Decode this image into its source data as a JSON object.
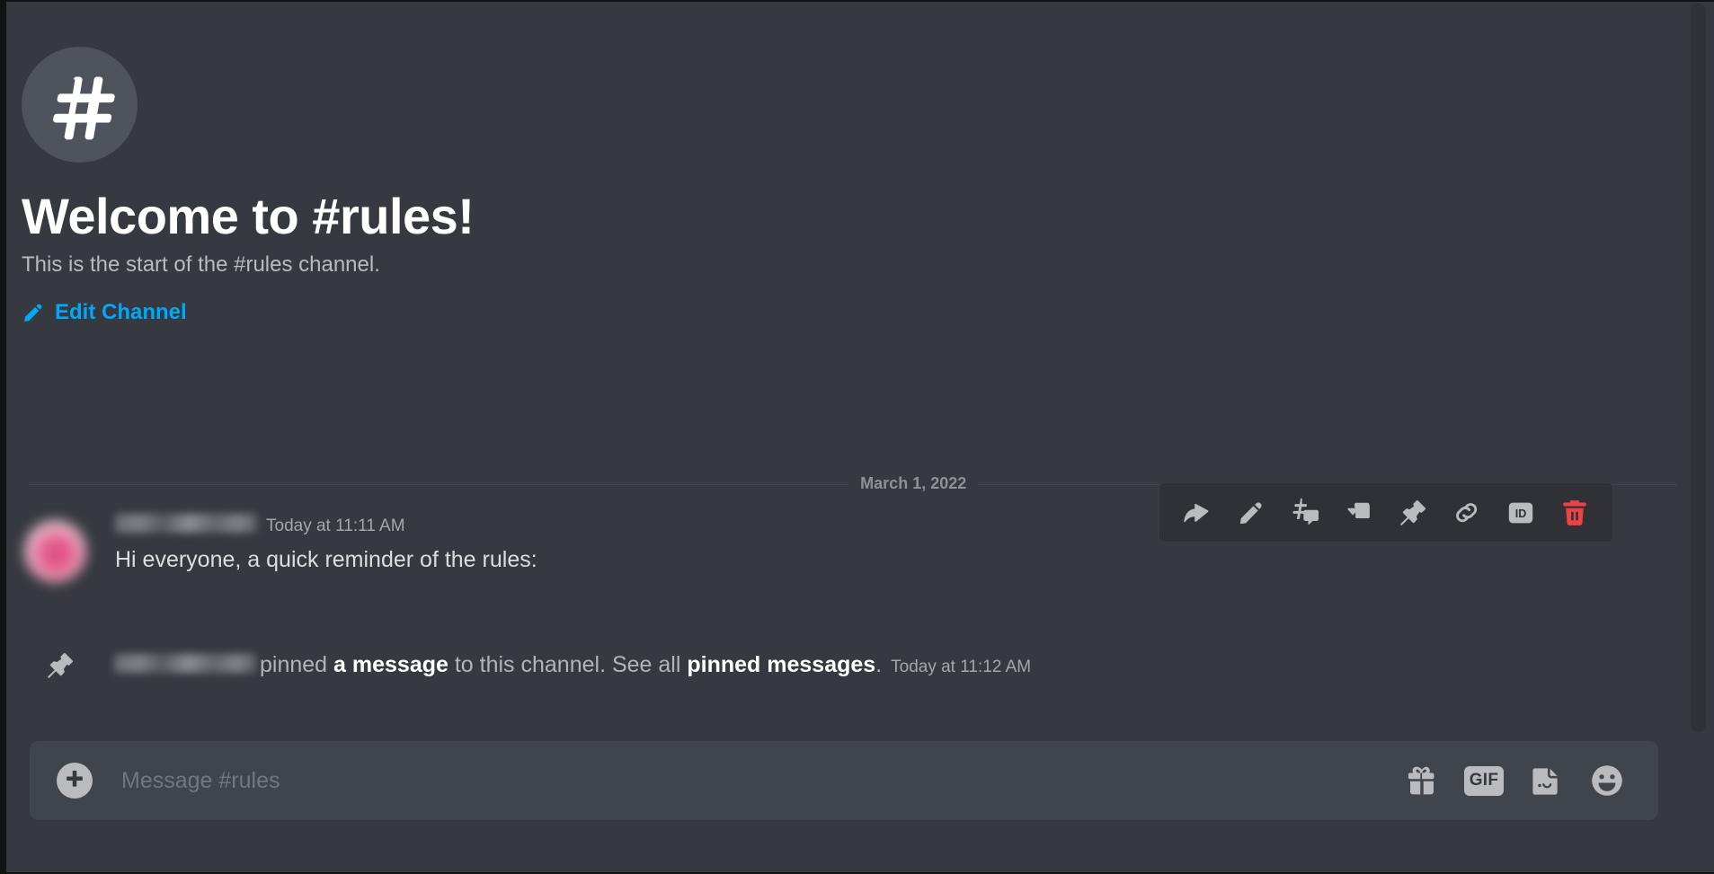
{
  "app": {
    "platform": "discord-channel-view",
    "background_color": "#36393f",
    "accent_color": "#00a8fc",
    "danger_color": "#ed4245"
  },
  "channel": {
    "name": "#rules",
    "welcome_title": "Welcome to #rules!",
    "intro_text": "This is the start of the #rules channel.",
    "edit_channel_label": "Edit Channel",
    "hash_icon": "hash-icon",
    "edit_icon": "pencil-icon"
  },
  "date_divider": {
    "label": "March 1, 2022"
  },
  "message": {
    "author_redacted": "",
    "timestamp": "Today at 11:11 AM",
    "content": "Hi everyone, a quick reminder of the rules:"
  },
  "hover_toolbar": {
    "buttons": [
      {
        "name": "reply-icon",
        "label": "Reply"
      },
      {
        "name": "edit-pencil-icon",
        "label": "Edit"
      },
      {
        "name": "crosspost-icon",
        "label": "Publish"
      },
      {
        "name": "mark-unread-icon",
        "label": "Mark Unread"
      },
      {
        "name": "pin-icon",
        "label": "Pin Message"
      },
      {
        "name": "copy-link-icon",
        "label": "Copy Message Link"
      },
      {
        "name": "copy-id-icon",
        "label": "ID"
      },
      {
        "name": "delete-trash-icon",
        "label": "Delete"
      }
    ],
    "id_badge_text": "ID"
  },
  "pinned_system_message": {
    "icon": "pin-icon",
    "author_redacted": "",
    "text_before": "pinned",
    "pinned_link": "a message",
    "text_middle": "to this channel. See all",
    "pinned_messages_link": "pinned messages",
    "text_after": ".",
    "timestamp": "Today at 11:12 AM"
  },
  "composer": {
    "placeholder": "Message #rules",
    "value": "",
    "attach_icon": "plus-circle-icon",
    "actions": [
      {
        "name": "gift-icon",
        "label": "Gift"
      },
      {
        "name": "gif-icon",
        "label": "GIF"
      },
      {
        "name": "sticker-icon",
        "label": "Sticker"
      },
      {
        "name": "emoji-icon",
        "label": "Emoji"
      }
    ]
  },
  "scrollbar": {
    "orientation": "vertical",
    "position": "top"
  }
}
